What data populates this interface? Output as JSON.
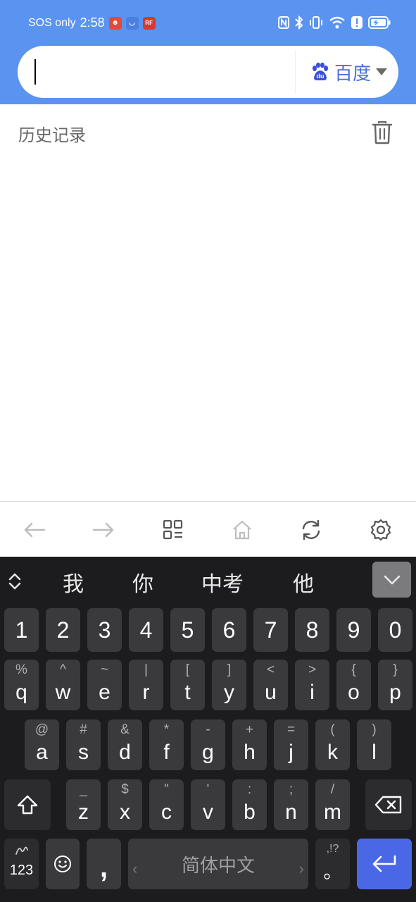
{
  "status_bar": {
    "carrier": "SOS only",
    "time": "2:58",
    "app_badges": [
      {
        "name": "app-badge-1",
        "color": "#e24a3b",
        "glyph": "☻"
      },
      {
        "name": "app-badge-2",
        "color": "#4a7fe0",
        "glyph": "◡"
      },
      {
        "name": "app-badge-3",
        "color": "#d43a30",
        "glyph": "RF"
      }
    ],
    "icons": [
      "nfc-icon",
      "bluetooth-icon",
      "vibrate-icon",
      "wifi-icon",
      "alert-icon",
      "battery-icon"
    ]
  },
  "search": {
    "value": "",
    "engine_label": "百度",
    "engine_icon": "baidu-paw-icon",
    "accent": "#4a6de0"
  },
  "history": {
    "title": "历史记录",
    "clear_icon": "trash-icon"
  },
  "browser_bar": {
    "buttons": [
      {
        "name": "back-icon",
        "enabled": false
      },
      {
        "name": "forward-icon",
        "enabled": false
      },
      {
        "name": "tabs-icon",
        "enabled": true
      },
      {
        "name": "home-icon",
        "enabled": false
      },
      {
        "name": "refresh-icon",
        "enabled": true
      },
      {
        "name": "settings-icon",
        "enabled": true
      }
    ]
  },
  "keyboard": {
    "candidates": [
      "我",
      "你",
      "中考",
      "他"
    ],
    "row_numbers": [
      "1",
      "2",
      "3",
      "4",
      "5",
      "6",
      "7",
      "8",
      "9",
      "0"
    ],
    "row1": [
      {
        "sub": "%",
        "main": "q"
      },
      {
        "sub": "^",
        "main": "w"
      },
      {
        "sub": "~",
        "main": "e"
      },
      {
        "sub": "|",
        "main": "r"
      },
      {
        "sub": "[",
        "main": "t"
      },
      {
        "sub": "]",
        "main": "y"
      },
      {
        "sub": "<",
        "main": "u"
      },
      {
        "sub": ">",
        "main": "i"
      },
      {
        "sub": "{",
        "main": "o"
      },
      {
        "sub": "}",
        "main": "p"
      }
    ],
    "row2": [
      {
        "sub": "@",
        "main": "a"
      },
      {
        "sub": "#",
        "main": "s"
      },
      {
        "sub": "&",
        "main": "d"
      },
      {
        "sub": "*",
        "main": "f"
      },
      {
        "sub": "-",
        "main": "g"
      },
      {
        "sub": "+",
        "main": "h"
      },
      {
        "sub": "=",
        "main": "j"
      },
      {
        "sub": "(",
        "main": "k"
      },
      {
        "sub": ")",
        "main": "l"
      }
    ],
    "row3": [
      {
        "sub": "_",
        "main": "z"
      },
      {
        "sub": "$",
        "main": "x"
      },
      {
        "sub": "\"",
        "main": "c"
      },
      {
        "sub": "'",
        "main": "v"
      },
      {
        "sub": ":",
        "main": "b"
      },
      {
        "sub": ";",
        "main": "n"
      },
      {
        "sub": "/",
        "main": "m"
      }
    ],
    "symbols_label": "123",
    "comma_label": ",",
    "space_label": "简体中文",
    "period_sub": ",!?",
    "period_main": "。",
    "enter_color": "#4a68e6"
  }
}
